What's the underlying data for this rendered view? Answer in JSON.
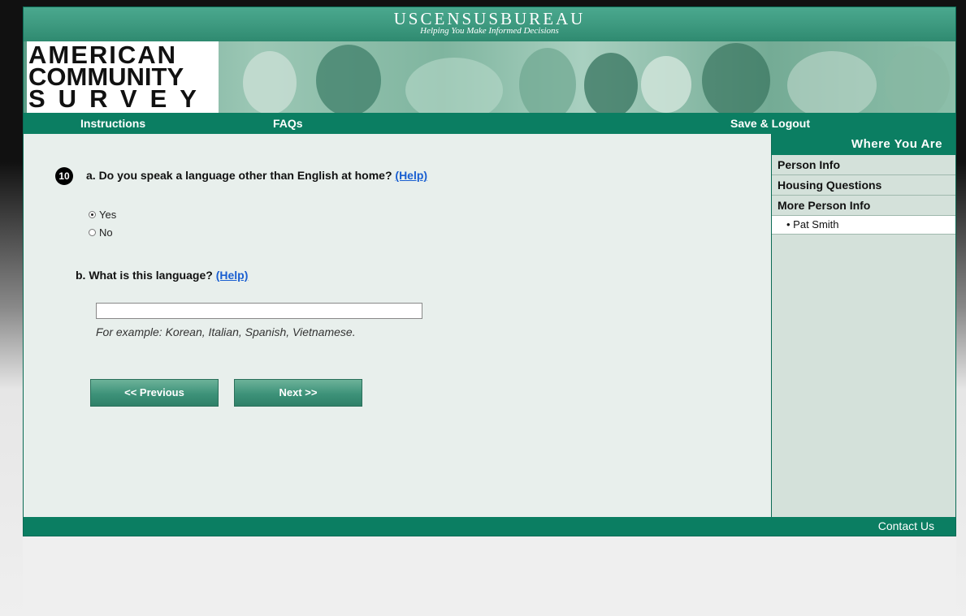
{
  "header": {
    "agency": "USCENSUSBUREAU",
    "tagline": "Helping You Make Informed Decisions",
    "logo_line1": "AMERICAN",
    "logo_line2": "COMMUNITY",
    "logo_line3": "SURVEY"
  },
  "nav": {
    "instructions": "Instructions",
    "faqs": "FAQs",
    "save_logout": "Save & Logout"
  },
  "question": {
    "number": "10",
    "a_text": "a. Do you speak a language other than English at home?",
    "help_label": "(Help)",
    "options": [
      {
        "label": "Yes",
        "selected": true
      },
      {
        "label": "No",
        "selected": false
      }
    ],
    "b_text": "b. What is this language?",
    "language_value": "",
    "example": "For example: Korean, Italian, Spanish, Vietnamese."
  },
  "buttons": {
    "previous": "<<   Previous",
    "next": "Next   >>"
  },
  "sidebar": {
    "title": "Where You Are",
    "items": [
      "Person Info",
      "Housing Questions",
      "More Person Info"
    ],
    "sub_item": "• Pat Smith"
  },
  "footer": {
    "contact": "Contact Us"
  },
  "colors": {
    "primary_green": "#0b7e62",
    "background": "#e8efec",
    "sidebar": "#d4e1da",
    "link": "#1a5fd1"
  }
}
